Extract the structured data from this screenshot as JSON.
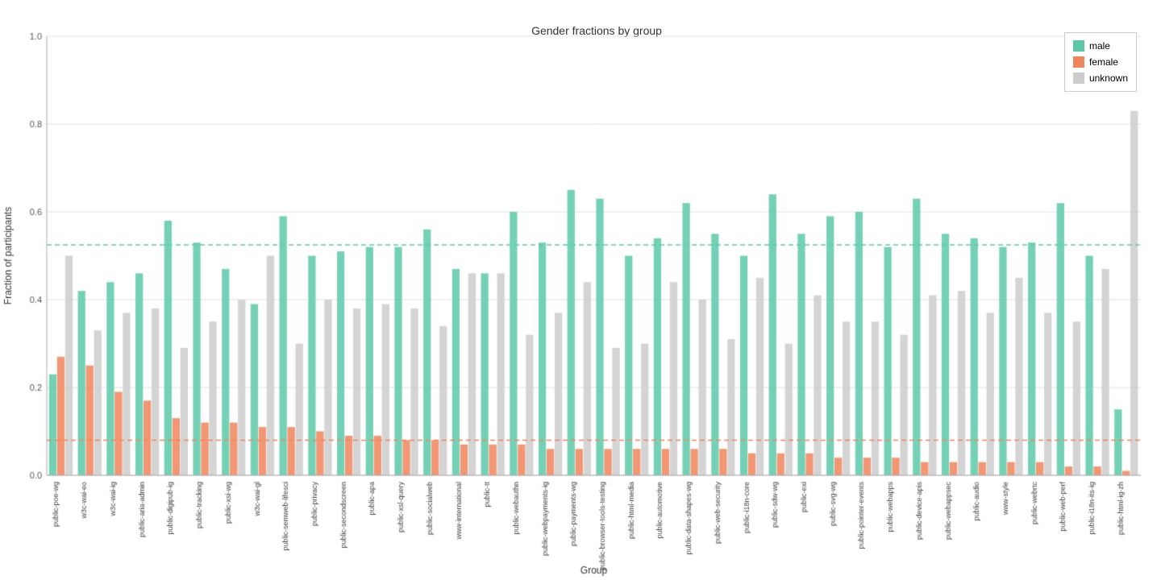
{
  "chart": {
    "title": "Gender fractions by group",
    "x_label": "Group",
    "y_label": "Fraction of participants",
    "colors": {
      "male": "#5dc9a8",
      "female": "#f0845a",
      "unknown": "#cccccc"
    },
    "reference_lines": {
      "male": 0.525,
      "female": 0.08
    },
    "groups": [
      {
        "name": "public-poe-wg",
        "male": 0.23,
        "female": 0.27,
        "unknown": 0.5
      },
      {
        "name": "w3c-wai-eo",
        "male": 0.42,
        "female": 0.25,
        "unknown": 0.33
      },
      {
        "name": "w3c-wai-ig",
        "male": 0.44,
        "female": 0.19,
        "unknown": 0.37
      },
      {
        "name": "public-aria-admin",
        "male": 0.46,
        "female": 0.17,
        "unknown": 0.38
      },
      {
        "name": "public-digipub-ig",
        "male": 0.58,
        "female": 0.13,
        "unknown": 0.29
      },
      {
        "name": "public-tracking",
        "male": 0.53,
        "female": 0.12,
        "unknown": 0.35
      },
      {
        "name": "public-xsi-wg",
        "male": 0.47,
        "female": 0.12,
        "unknown": 0.4
      },
      {
        "name": "w3c-wai-gl",
        "male": 0.39,
        "female": 0.11,
        "unknown": 0.5
      },
      {
        "name": "public-semweb-lifesci",
        "male": 0.59,
        "female": 0.11,
        "unknown": 0.3
      },
      {
        "name": "public-privacy",
        "male": 0.5,
        "female": 0.1,
        "unknown": 0.4
      },
      {
        "name": "public-secondscreen",
        "male": 0.51,
        "female": 0.09,
        "unknown": 0.38
      },
      {
        "name": "public-apa",
        "male": 0.52,
        "female": 0.09,
        "unknown": 0.39
      },
      {
        "name": "public-xsl-query",
        "male": 0.52,
        "female": 0.08,
        "unknown": 0.38
      },
      {
        "name": "public-socialweb",
        "male": 0.56,
        "female": 0.08,
        "unknown": 0.34
      },
      {
        "name": "www-international",
        "male": 0.47,
        "female": 0.07,
        "unknown": 0.46
      },
      {
        "name": "public-tt",
        "male": 0.46,
        "female": 0.07,
        "unknown": 0.46
      },
      {
        "name": "public-webauthn",
        "male": 0.6,
        "female": 0.07,
        "unknown": 0.32
      },
      {
        "name": "public-webpayments-ig",
        "male": 0.53,
        "female": 0.06,
        "unknown": 0.37
      },
      {
        "name": "public-payments-wg",
        "male": 0.65,
        "female": 0.06,
        "unknown": 0.44
      },
      {
        "name": "public-browser-tools-testing",
        "male": 0.63,
        "female": 0.06,
        "unknown": 0.29
      },
      {
        "name": "public-html-media",
        "male": 0.5,
        "female": 0.06,
        "unknown": 0.3
      },
      {
        "name": "public-automotive",
        "male": 0.54,
        "female": 0.06,
        "unknown": 0.44
      },
      {
        "name": "public-data-shapes-wg",
        "male": 0.62,
        "female": 0.06,
        "unknown": 0.4
      },
      {
        "name": "public-web-security",
        "male": 0.55,
        "female": 0.06,
        "unknown": 0.31
      },
      {
        "name": "public-i18n-core",
        "male": 0.5,
        "female": 0.05,
        "unknown": 0.45
      },
      {
        "name": "public-sdw-wg",
        "male": 0.64,
        "female": 0.05,
        "unknown": 0.3
      },
      {
        "name": "public-exi",
        "male": 0.55,
        "female": 0.05,
        "unknown": 0.41
      },
      {
        "name": "public-svg-wg",
        "male": 0.59,
        "female": 0.04,
        "unknown": 0.35
      },
      {
        "name": "public-pointer-events",
        "male": 0.6,
        "female": 0.04,
        "unknown": 0.35
      },
      {
        "name": "public-webapps",
        "male": 0.52,
        "female": 0.04,
        "unknown": 0.32
      },
      {
        "name": "public-device-apis",
        "male": 0.63,
        "female": 0.03,
        "unknown": 0.41
      },
      {
        "name": "public-webappsec",
        "male": 0.55,
        "female": 0.03,
        "unknown": 0.42
      },
      {
        "name": "public-audio",
        "male": 0.54,
        "female": 0.03,
        "unknown": 0.37
      },
      {
        "name": "www-style",
        "male": 0.52,
        "female": 0.03,
        "unknown": 0.45
      },
      {
        "name": "public-webrtc",
        "male": 0.53,
        "female": 0.03,
        "unknown": 0.37
      },
      {
        "name": "public-web-perf",
        "male": 0.62,
        "female": 0.02,
        "unknown": 0.35
      },
      {
        "name": "public-i18n-its-ig",
        "male": 0.5,
        "female": 0.02,
        "unknown": 0.47
      },
      {
        "name": "public-html-ig-zh",
        "male": 0.15,
        "female": 0.01,
        "unknown": 0.83
      }
    ],
    "legend": {
      "male_label": "male",
      "female_label": "female",
      "unknown_label": "unknown"
    },
    "y_ticks": [
      0.0,
      0.2,
      0.4,
      0.6,
      0.8,
      1.0
    ]
  }
}
